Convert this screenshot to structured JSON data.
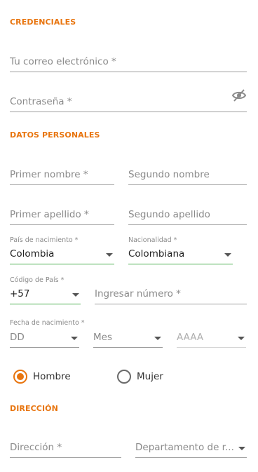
{
  "credentials": {
    "title": "CREDENCIALES",
    "email_placeholder": "Tu correo electrónico *",
    "password_placeholder": "Contraseña *",
    "password_toggle_icon": "eye-slash-icon"
  },
  "personal": {
    "title": "DATOS PERSONALES",
    "first_name_placeholder": "Primer nombre *",
    "middle_name_placeholder": "Segundo nombre",
    "first_lastname_placeholder": "Primer apellido *",
    "second_lastname_placeholder": "Segundo apellido",
    "birth_country": {
      "caption": "País de nacimiento *",
      "value": "Colombia"
    },
    "nationality": {
      "caption": "Nacionalidad *",
      "value": "Colombiana"
    },
    "country_code": {
      "caption": "Código de País *",
      "value": "+57"
    },
    "phone_placeholder": "Ingresar número *",
    "birth_date": {
      "caption": "Fecha de nacimiento *",
      "day": "DD",
      "month": "Mes",
      "year": "AAAA"
    },
    "gender": {
      "options": [
        "Hombre",
        "Mujer"
      ],
      "selected": "Hombre"
    }
  },
  "address": {
    "title": "DIRECCIÓN",
    "address_placeholder": "Dirección *",
    "department_placeholder": "Departamento de r..."
  },
  "colors": {
    "accent": "#e8750f",
    "focus_green": "#4caf50"
  }
}
